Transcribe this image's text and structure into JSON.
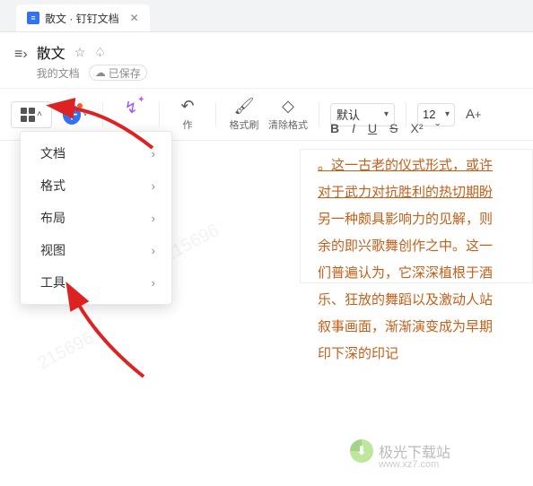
{
  "tab": {
    "title": "散文 · 钉钉文档"
  },
  "header": {
    "doc_title": "散文",
    "breadcrumb": "我的文档",
    "saved_label": "已保存"
  },
  "toolbar": {
    "undo_label": "作",
    "format_painter": "格式刷",
    "clear_format": "清除格式",
    "font_name": "默认",
    "font_size": "12",
    "fmt": {
      "b": "B",
      "i": "I",
      "u": "U",
      "s": "S",
      "sup": "X²",
      "color_chev": "ˇ"
    }
  },
  "menu": {
    "items": [
      {
        "label": "文档"
      },
      {
        "label": "格式"
      },
      {
        "label": "布局"
      },
      {
        "label": "视图"
      },
      {
        "label": "工具"
      }
    ]
  },
  "doc_text": {
    "l1": "。这一古老的仪式形式，或许",
    "l2": "对于武力对抗胜利的热切期盼",
    "l3": "另一种颇具影响力的见解，则",
    "l4": "余的即兴歌舞创作之中。这一",
    "l5": "们普遍认为，它深深植根于酒",
    "l6": "乐、狂放的舞蹈以及激动人站",
    "l7": "叙事画面，渐渐演变成为早期",
    "l8": "印下深的印记"
  },
  "watermark": {
    "site_name": "极光下载站",
    "site_url": "www.xz7.com",
    "bg_text": "215696"
  }
}
